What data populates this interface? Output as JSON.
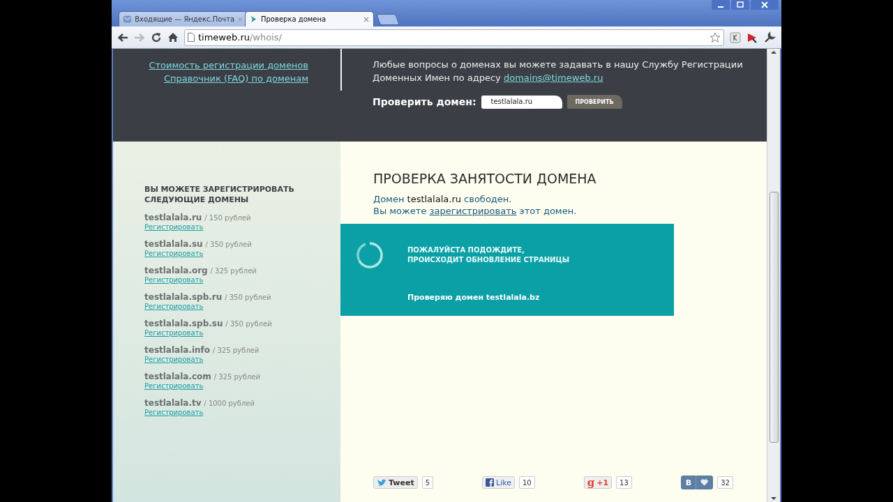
{
  "browser": {
    "tabs": [
      {
        "title": "Входящие — Яндекс.Почта",
        "kind": "mail",
        "selected": false
      },
      {
        "title": "Проверка домена",
        "kind": "site",
        "selected": true
      }
    ],
    "address": {
      "host": "timeweb.ru",
      "path": "/whois/"
    }
  },
  "header": {
    "links": [
      "Стоимость регистрации доменов",
      "Справочник (FAQ) по доменам"
    ],
    "info": "Любые вопросы о доменах вы можете задавать в нашу Службу Регистрации Доменных Имен по адресу",
    "email": "domains@timeweb.ru",
    "check_label": "Проверить домен:",
    "check_field": {
      "value": "testlalala.ru"
    },
    "check_button": "ПРОВЕРИТЬ"
  },
  "sidebar": {
    "title": "ВЫ МОЖЕТЕ ЗАРЕГИСТРИРОВАТЬ СЛЕДУЮЩИЕ ДОМЕНЫ",
    "domains": [
      {
        "name": "testlalala.ru",
        "price": "/ 150 рублей",
        "link": "Регистрировать"
      },
      {
        "name": "testlalala.su",
        "price": "/ 350 рублей",
        "link": "Регистрировать"
      },
      {
        "name": "testlalala.org",
        "price": "/ 325 рублей",
        "link": "Регистрировать"
      },
      {
        "name": "testlalala.spb.ru",
        "price": "/ 350 рублей",
        "link": "Регистрировать"
      },
      {
        "name": "testlalala.spb.su",
        "price": "/ 350 рублей",
        "link": "Регистрировать"
      },
      {
        "name": "testlalala.info",
        "price": "/ 325 рублей",
        "link": "Регистрировать"
      },
      {
        "name": "testlalala.com",
        "price": "/ 325 рублей",
        "link": "Регистрировать"
      },
      {
        "name": "testlalala.tv",
        "price": "/ 1000 рублей",
        "link": "Регистрировать"
      }
    ]
  },
  "result": {
    "title": "ПРОВЕРКА ЗАНЯТОСТИ ДОМЕНА",
    "status_prefix": "Домен",
    "domain": "testlalala.ru",
    "status_suffix": "свободен.",
    "offer_prefix": "Вы можете",
    "offer_link": "зарегистрировать",
    "offer_suffix": "этот домен."
  },
  "loading": {
    "title_lines": [
      "ПОЖАЛУЙСТА  ПОДОЖДИТЕ,",
      "ПРОИСХОДИТ ОБНОВЛЕНИЕ СТРАНИЦЫ"
    ],
    "progress": "Проверяю домен testlalala.bz"
  },
  "social": [
    {
      "kind": "twitter",
      "label": "Tweet",
      "count": "5"
    },
    {
      "kind": "facebook",
      "label": "Like",
      "count": "10"
    },
    {
      "kind": "google",
      "glyph": "g",
      "label": "+1",
      "count": "13"
    },
    {
      "kind": "vk",
      "glyph": "В",
      "count": "32"
    }
  ]
}
